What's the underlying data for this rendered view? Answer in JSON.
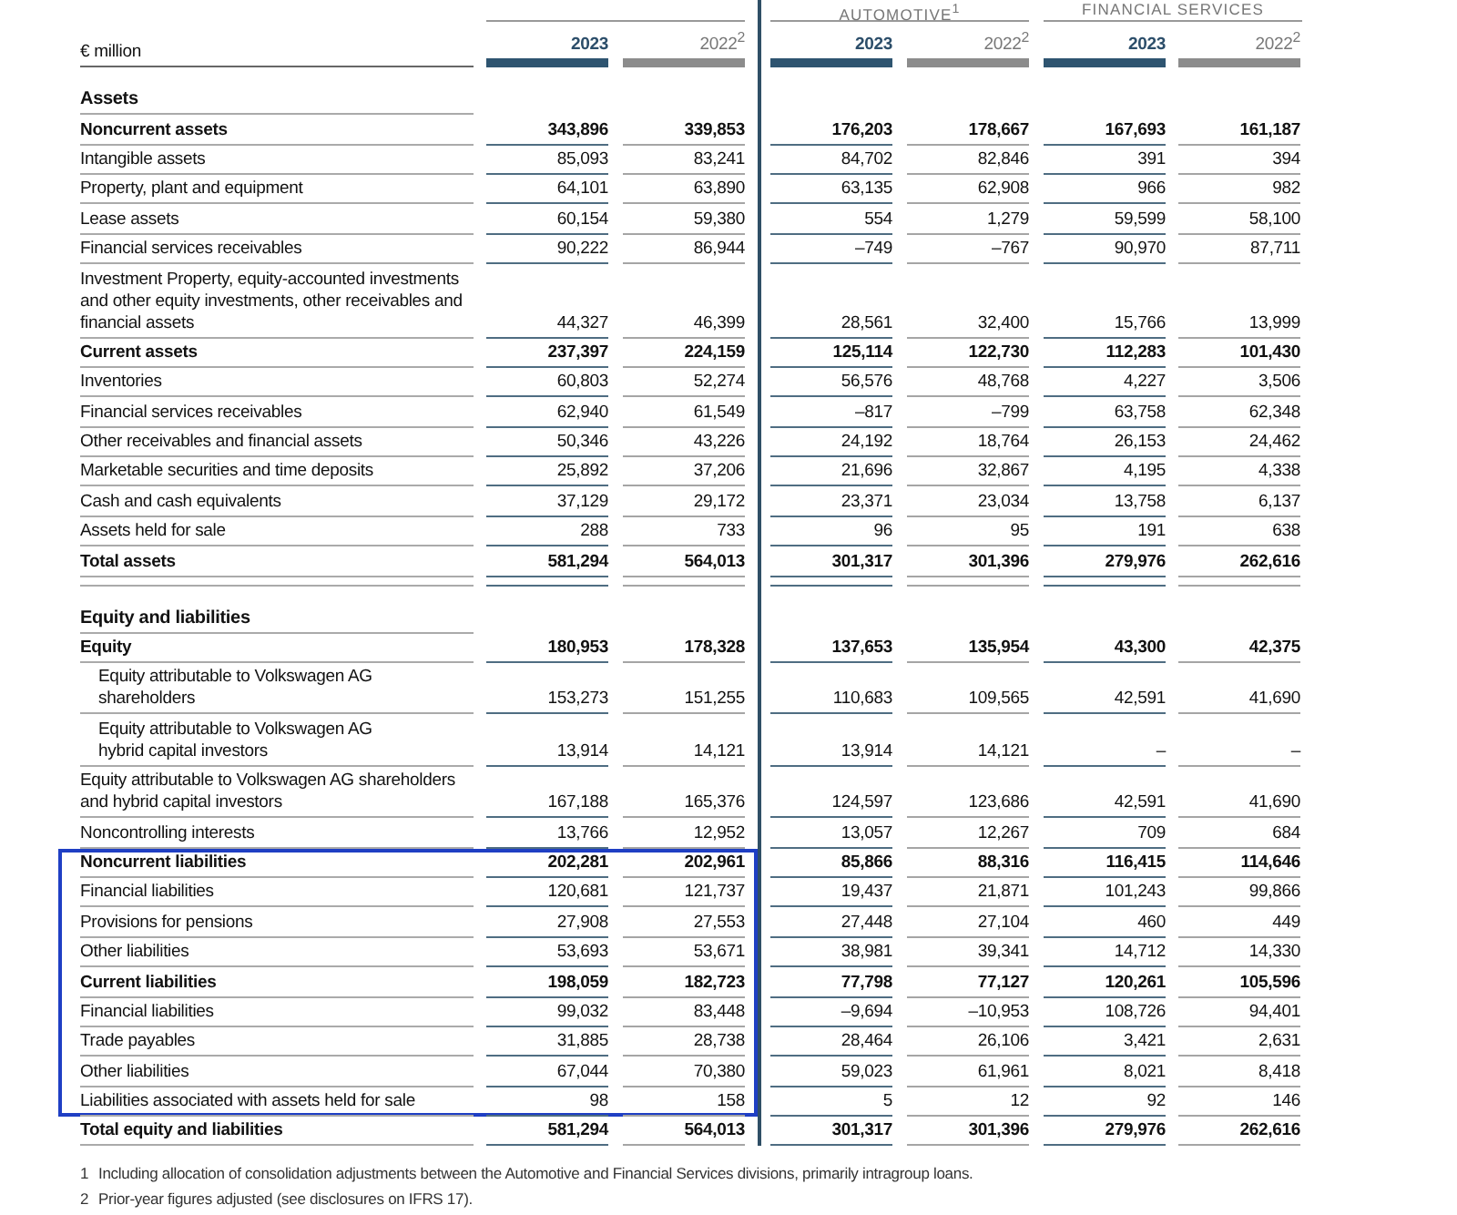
{
  "unit_label": "€ million",
  "groups": [
    {
      "columns": [
        {
          "year": "2023",
          "kind": "current"
        },
        {
          "year": "2022$^{2}$",
          "kind": "prior"
        }
      ]
    },
    {
      "label": "AUTOMOTIVE$^{1}$",
      "columns": [
        {
          "year": "2023",
          "kind": "current"
        },
        {
          "year": "2022$^{2}$",
          "kind": "prior"
        }
      ]
    },
    {
      "label": "FINANCIAL SERVICES",
      "columns": [
        {
          "year": "2023",
          "kind": "current"
        },
        {
          "year": "2022$^{2}$",
          "kind": "prior"
        }
      ]
    }
  ],
  "sections": [
    {
      "heading": "Assets",
      "rows": [
        {
          "label": "Noncurrent assets",
          "kind": "subtotal",
          "highlighted": false,
          "values": [
            "343,896",
            "339,853",
            "176,203",
            "178,667",
            "167,693",
            "161,187"
          ]
        },
        {
          "label": "Intangible assets",
          "kind": "item",
          "highlighted": false,
          "values": [
            "85,093",
            "83,241",
            "84,702",
            "82,846",
            "391",
            "394"
          ]
        },
        {
          "label": "Property, plant and equipment",
          "kind": "item",
          "highlighted": false,
          "values": [
            "64,101",
            "63,890",
            "63,135",
            "62,908",
            "966",
            "982"
          ]
        },
        {
          "label": "Lease assets",
          "kind": "item",
          "highlighted": false,
          "values": [
            "60,154",
            "59,380",
            "554",
            "1,279",
            "59,599",
            "58,100"
          ]
        },
        {
          "label": "Financial services receivables",
          "kind": "item",
          "highlighted": false,
          "values": [
            "90,222",
            "86,944",
            "–749",
            "–767",
            "90,970",
            "87,711"
          ]
        },
        {
          "label": "Investment Property, equity-accounted investments and other equity investments, other receivables and financial assets",
          "kind": "item",
          "highlighted": false,
          "values": [
            "44,327",
            "46,399",
            "28,561",
            "32,400",
            "15,766",
            "13,999"
          ]
        },
        {
          "label": "Current assets",
          "kind": "subtotal",
          "highlighted": false,
          "values": [
            "237,397",
            "224,159",
            "125,114",
            "122,730",
            "112,283",
            "101,430"
          ]
        },
        {
          "label": "Inventories",
          "kind": "item",
          "highlighted": false,
          "values": [
            "60,803",
            "52,274",
            "56,576",
            "48,768",
            "4,227",
            "3,506"
          ]
        },
        {
          "label": "Financial services receivables",
          "kind": "item",
          "highlighted": false,
          "values": [
            "62,940",
            "61,549",
            "–817",
            "–799",
            "63,758",
            "62,348"
          ]
        },
        {
          "label": "Other receivables and financial assets",
          "kind": "item",
          "highlighted": false,
          "values": [
            "50,346",
            "43,226",
            "24,192",
            "18,764",
            "26,153",
            "24,462"
          ]
        },
        {
          "label": "Marketable securities and time deposits",
          "kind": "item",
          "highlighted": false,
          "values": [
            "25,892",
            "37,206",
            "21,696",
            "32,867",
            "4,195",
            "4,338"
          ]
        },
        {
          "label": "Cash and cash equivalents",
          "kind": "item",
          "highlighted": false,
          "values": [
            "37,129",
            "29,172",
            "23,371",
            "23,034",
            "13,758",
            "6,137"
          ]
        },
        {
          "label": "Assets held for sale",
          "kind": "item",
          "highlighted": false,
          "values": [
            "288",
            "733",
            "96",
            "95",
            "191",
            "638"
          ]
        },
        {
          "label": "Total assets",
          "kind": "subtotal",
          "highlighted": false,
          "values": [
            "581,294",
            "564,013",
            "301,317",
            "301,396",
            "279,976",
            "262,616"
          ]
        }
      ]
    },
    {
      "heading": "Equity and liabilities",
      "rows": [
        {
          "label": "Equity",
          "kind": "subtotal",
          "highlighted": false,
          "values": [
            "180,953",
            "178,328",
            "137,653",
            "135,954",
            "43,300",
            "42,375"
          ]
        },
        {
          "label": "Equity attributable to Volkswagen AG shareholders",
          "kind": "subitem",
          "highlighted": false,
          "values": [
            "153,273",
            "151,255",
            "110,683",
            "109,565",
            "42,591",
            "41,690"
          ]
        },
        {
          "label": "Equity attributable to Volkswagen AG hybrid capital investors",
          "kind": "subitem",
          "highlighted": false,
          "values": [
            "13,914",
            "14,121",
            "13,914",
            "14,121",
            "–",
            "–"
          ]
        },
        {
          "label": "Equity attributable to Volkswagen AG shareholders and hybrid capital investors",
          "kind": "item",
          "highlighted": false,
          "values": [
            "167,188",
            "165,376",
            "124,597",
            "123,686",
            "42,591",
            "41,690"
          ]
        },
        {
          "label": "Noncontrolling interests",
          "kind": "item",
          "highlighted": false,
          "values": [
            "13,766",
            "12,952",
            "13,057",
            "12,267",
            "709",
            "684"
          ]
        },
        {
          "label": "Noncurrent liabilities",
          "kind": "subtotal",
          "highlighted": true,
          "values": [
            "202,281",
            "202,961",
            "85,866",
            "88,316",
            "116,415",
            "114,646"
          ]
        },
        {
          "label": "Financial liabilities",
          "kind": "item",
          "highlighted": true,
          "values": [
            "120,681",
            "121,737",
            "19,437",
            "21,871",
            "101,243",
            "99,866"
          ]
        },
        {
          "label": "Provisions for pensions",
          "kind": "item",
          "highlighted": true,
          "values": [
            "27,908",
            "27,553",
            "27,448",
            "27,104",
            "460",
            "449"
          ]
        },
        {
          "label": "Other liabilities",
          "kind": "item",
          "highlighted": true,
          "values": [
            "53,693",
            "53,671",
            "38,981",
            "39,341",
            "14,712",
            "14,330"
          ]
        },
        {
          "label": "Current liabilities",
          "kind": "subtotal",
          "highlighted": true,
          "values": [
            "198,059",
            "182,723",
            "77,798",
            "77,127",
            "120,261",
            "105,596"
          ]
        },
        {
          "label": "Financial liabilities",
          "kind": "item",
          "highlighted": true,
          "values": [
            "99,032",
            "83,448",
            "–9,694",
            "–10,953",
            "108,726",
            "94,401"
          ]
        },
        {
          "label": "Trade payables",
          "kind": "item",
          "highlighted": true,
          "values": [
            "31,885",
            "28,738",
            "28,464",
            "26,106",
            "3,421",
            "2,631"
          ]
        },
        {
          "label": "Other liabilities",
          "kind": "item",
          "highlighted": true,
          "values": [
            "67,044",
            "70,380",
            "59,023",
            "61,961",
            "8,021",
            "8,418"
          ]
        },
        {
          "label": "Liabilities associated with assets held for sale",
          "kind": "item",
          "highlighted": true,
          "values": [
            "98",
            "158",
            "5",
            "12",
            "92",
            "146"
          ]
        },
        {
          "label": "Total equity and liabilities",
          "kind": "subtotal",
          "highlighted": false,
          "values": [
            "581,294",
            "564,013",
            "301,317",
            "301,396",
            "279,976",
            "262,616"
          ]
        }
      ]
    }
  ],
  "footnotes": [
    {
      "mark": "1",
      "text": "Including allocation of consolidation adjustments between the Automotive and Financial Services divisions, primarily intragroup loans."
    },
    {
      "mark": "2",
      "text": "Prior-year figures adjusted (see disclosures on IFRS 17)."
    }
  ]
}
